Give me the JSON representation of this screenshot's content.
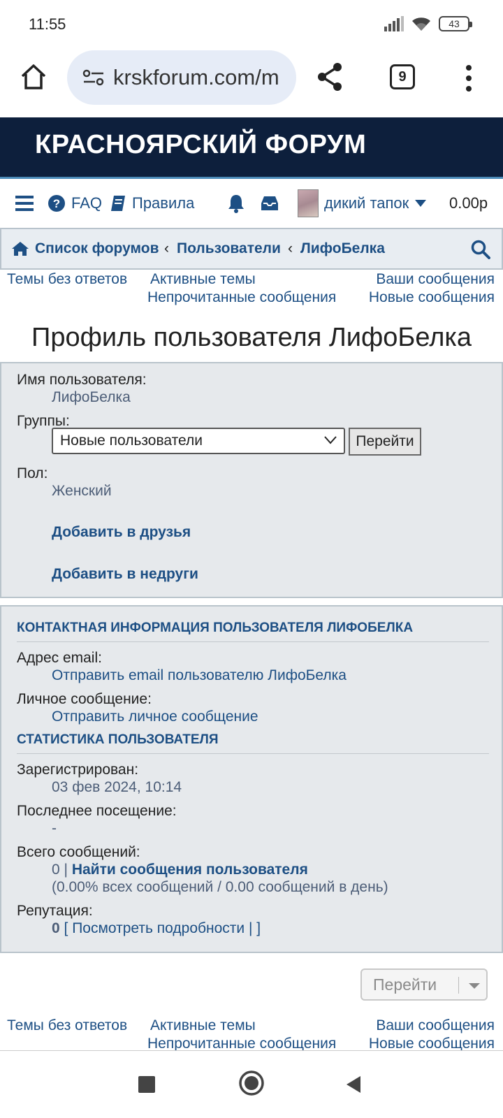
{
  "status": {
    "time": "11:55",
    "battery": "43"
  },
  "browser": {
    "url": "krskforum.com/m",
    "tab_count": "9"
  },
  "banner": {
    "title": "КРАСНОЯРСКИЙ ФОРУМ"
  },
  "navbar": {
    "faq": "FAQ",
    "rules": "Правила",
    "username": "дикий тапок",
    "balance": "0.00р"
  },
  "breadcrumb": {
    "forums": "Список форумов",
    "users": "Пользователи",
    "current": "ЛифоБелка"
  },
  "quicklinks": {
    "unanswered": "Темы без ответов",
    "active": "Активные темы",
    "yours": "Ваши сообщения",
    "unread": "Непрочитанные сообщения",
    "new": "Новые сообщения"
  },
  "page_title": "Профиль пользователя ЛифоБелка",
  "profile": {
    "username_label": "Имя пользователя:",
    "username_value": "ЛифоБелка",
    "groups_label": "Группы:",
    "groups_selected": "Новые пользователи",
    "go_button": "Перейти",
    "gender_label": "Пол:",
    "gender_value": "Женский",
    "add_friend": "Добавить в друзья",
    "add_foe": "Добавить в недруги"
  },
  "contact": {
    "heading": "КОНТАКТНАЯ ИНФОРМАЦИЯ ПОЛЬЗОВАТЕЛЯ ЛИФОБЕЛКА",
    "email_label": "Адрес email:",
    "email_link": "Отправить email пользователю ЛифоБелка",
    "pm_label": "Личное сообщение:",
    "pm_link": "Отправить личное сообщение"
  },
  "stats": {
    "heading": "СТАТИСТИКА ПОЛЬЗОВАТЕЛЯ",
    "registered_label": "Зарегистрирован:",
    "registered_value": "03 фев 2024, 10:14",
    "last_visit_label": "Последнее посещение:",
    "last_visit_value": "-",
    "posts_label": "Всего сообщений:",
    "posts_count": "0 |",
    "posts_search": "Найти сообщения пользователя",
    "posts_ratio": "(0.00% всех сообщений / 0.00 сообщений в день)",
    "rep_label": "Репутация:",
    "rep_value": "0",
    "rep_link": "[ Посмотреть подробности | ]"
  },
  "jump": {
    "label": "Перейти"
  }
}
